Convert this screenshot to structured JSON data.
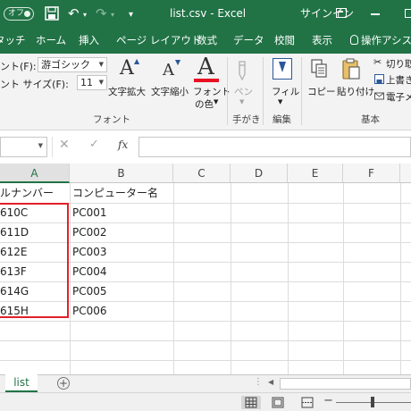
{
  "titlebar": {
    "autosave": "オフ",
    "title": "list.csv - Excel",
    "signin": "サインイン"
  },
  "tabs": {
    "touch": "タッチ",
    "home": "ホーム",
    "insert": "挿入",
    "layout": "ページ レイアウト",
    "formulas": "数式",
    "data": "データ",
    "review": "校閲",
    "view": "表示",
    "tell": "操作アシスト"
  },
  "ribbon": {
    "font_label": "ント(F):",
    "font_value": "游ゴシック",
    "size_label": "ント サイズ(F):",
    "size_value": "11",
    "grow_font": "文字拡大",
    "shrink_font": "文字縮小",
    "font_color_1": "フォント",
    "font_color_2": "の色",
    "pen": "ペン",
    "fill": "フィル",
    "copy": "コピー",
    "paste": "貼り付け",
    "cut": "切り取",
    "overwrite": "上書き",
    "email": "電子メ",
    "group_font": "フォント",
    "group_ink": "手がき",
    "group_edit": "編集",
    "group_basic": "基本",
    "font_color_hex": "#e81123"
  },
  "formula_bar": {
    "fx": "fx",
    "cancel_icon": "close-icon",
    "enter_icon": "check-icon"
  },
  "grid": {
    "columns": [
      "A",
      "B",
      "C",
      "D",
      "E",
      "F"
    ],
    "header_a": "ルナンバー",
    "header_b": "コンピューター名",
    "rows": [
      {
        "a": "610C",
        "b": "PC001"
      },
      {
        "a": "611D",
        "b": "PC002"
      },
      {
        "a": "612E",
        "b": "PC003"
      },
      {
        "a": "613F",
        "b": "PC004"
      },
      {
        "a": "614G",
        "b": "PC005"
      },
      {
        "a": "615H",
        "b": "PC006"
      }
    ],
    "highlight_color": "#e0202a"
  },
  "sheets": {
    "active": "list",
    "add": "+"
  },
  "status": {
    "zoom_minus": "−"
  },
  "colors": {
    "brand": "#217346"
  }
}
